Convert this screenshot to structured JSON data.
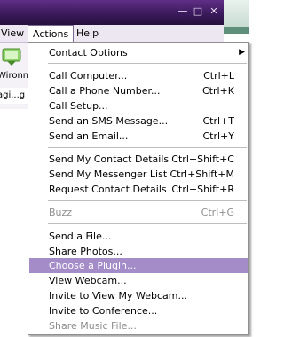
{
  "window": {
    "controls": [
      "minimize",
      "maximize",
      "close"
    ]
  },
  "menubar": {
    "view": "View",
    "actions": "Actions",
    "help": "Help"
  },
  "toolbar": {
    "label": "Wironme",
    "field": "agi...g"
  },
  "menu": {
    "contact_options": "Contact Options",
    "call_computer": {
      "label": "Call Computer...",
      "shortcut": "Ctrl+L"
    },
    "call_phone": {
      "label": "Call a Phone Number...",
      "shortcut": "Ctrl+K"
    },
    "call_setup": {
      "label": "Call Setup..."
    },
    "send_sms": {
      "label": "Send an SMS Message...",
      "shortcut": "Ctrl+T"
    },
    "send_email": {
      "label": "Send an Email...",
      "shortcut": "Ctrl+Y"
    },
    "send_contact_details": {
      "label": "Send My Contact Details",
      "shortcut": "Ctrl+Shift+C"
    },
    "send_messenger_list": {
      "label": "Send My Messenger List",
      "shortcut": "Ctrl+Shift+M"
    },
    "request_contact_details": {
      "label": "Request Contact Details",
      "shortcut": "Ctrl+Shift+R"
    },
    "buzz": {
      "label": "Buzz",
      "shortcut": "Ctrl+G"
    },
    "send_file": {
      "label": "Send a File..."
    },
    "share_photos": {
      "label": "Share Photos..."
    },
    "choose_plugin": {
      "label": "Choose a Plugin..."
    },
    "view_webcam": {
      "label": "View Webcam..."
    },
    "invite_webcam": {
      "label": "Invite to View My Webcam..."
    },
    "invite_conference": {
      "label": "Invite to Conference..."
    },
    "share_music": {
      "label": "Share Music File..."
    }
  }
}
